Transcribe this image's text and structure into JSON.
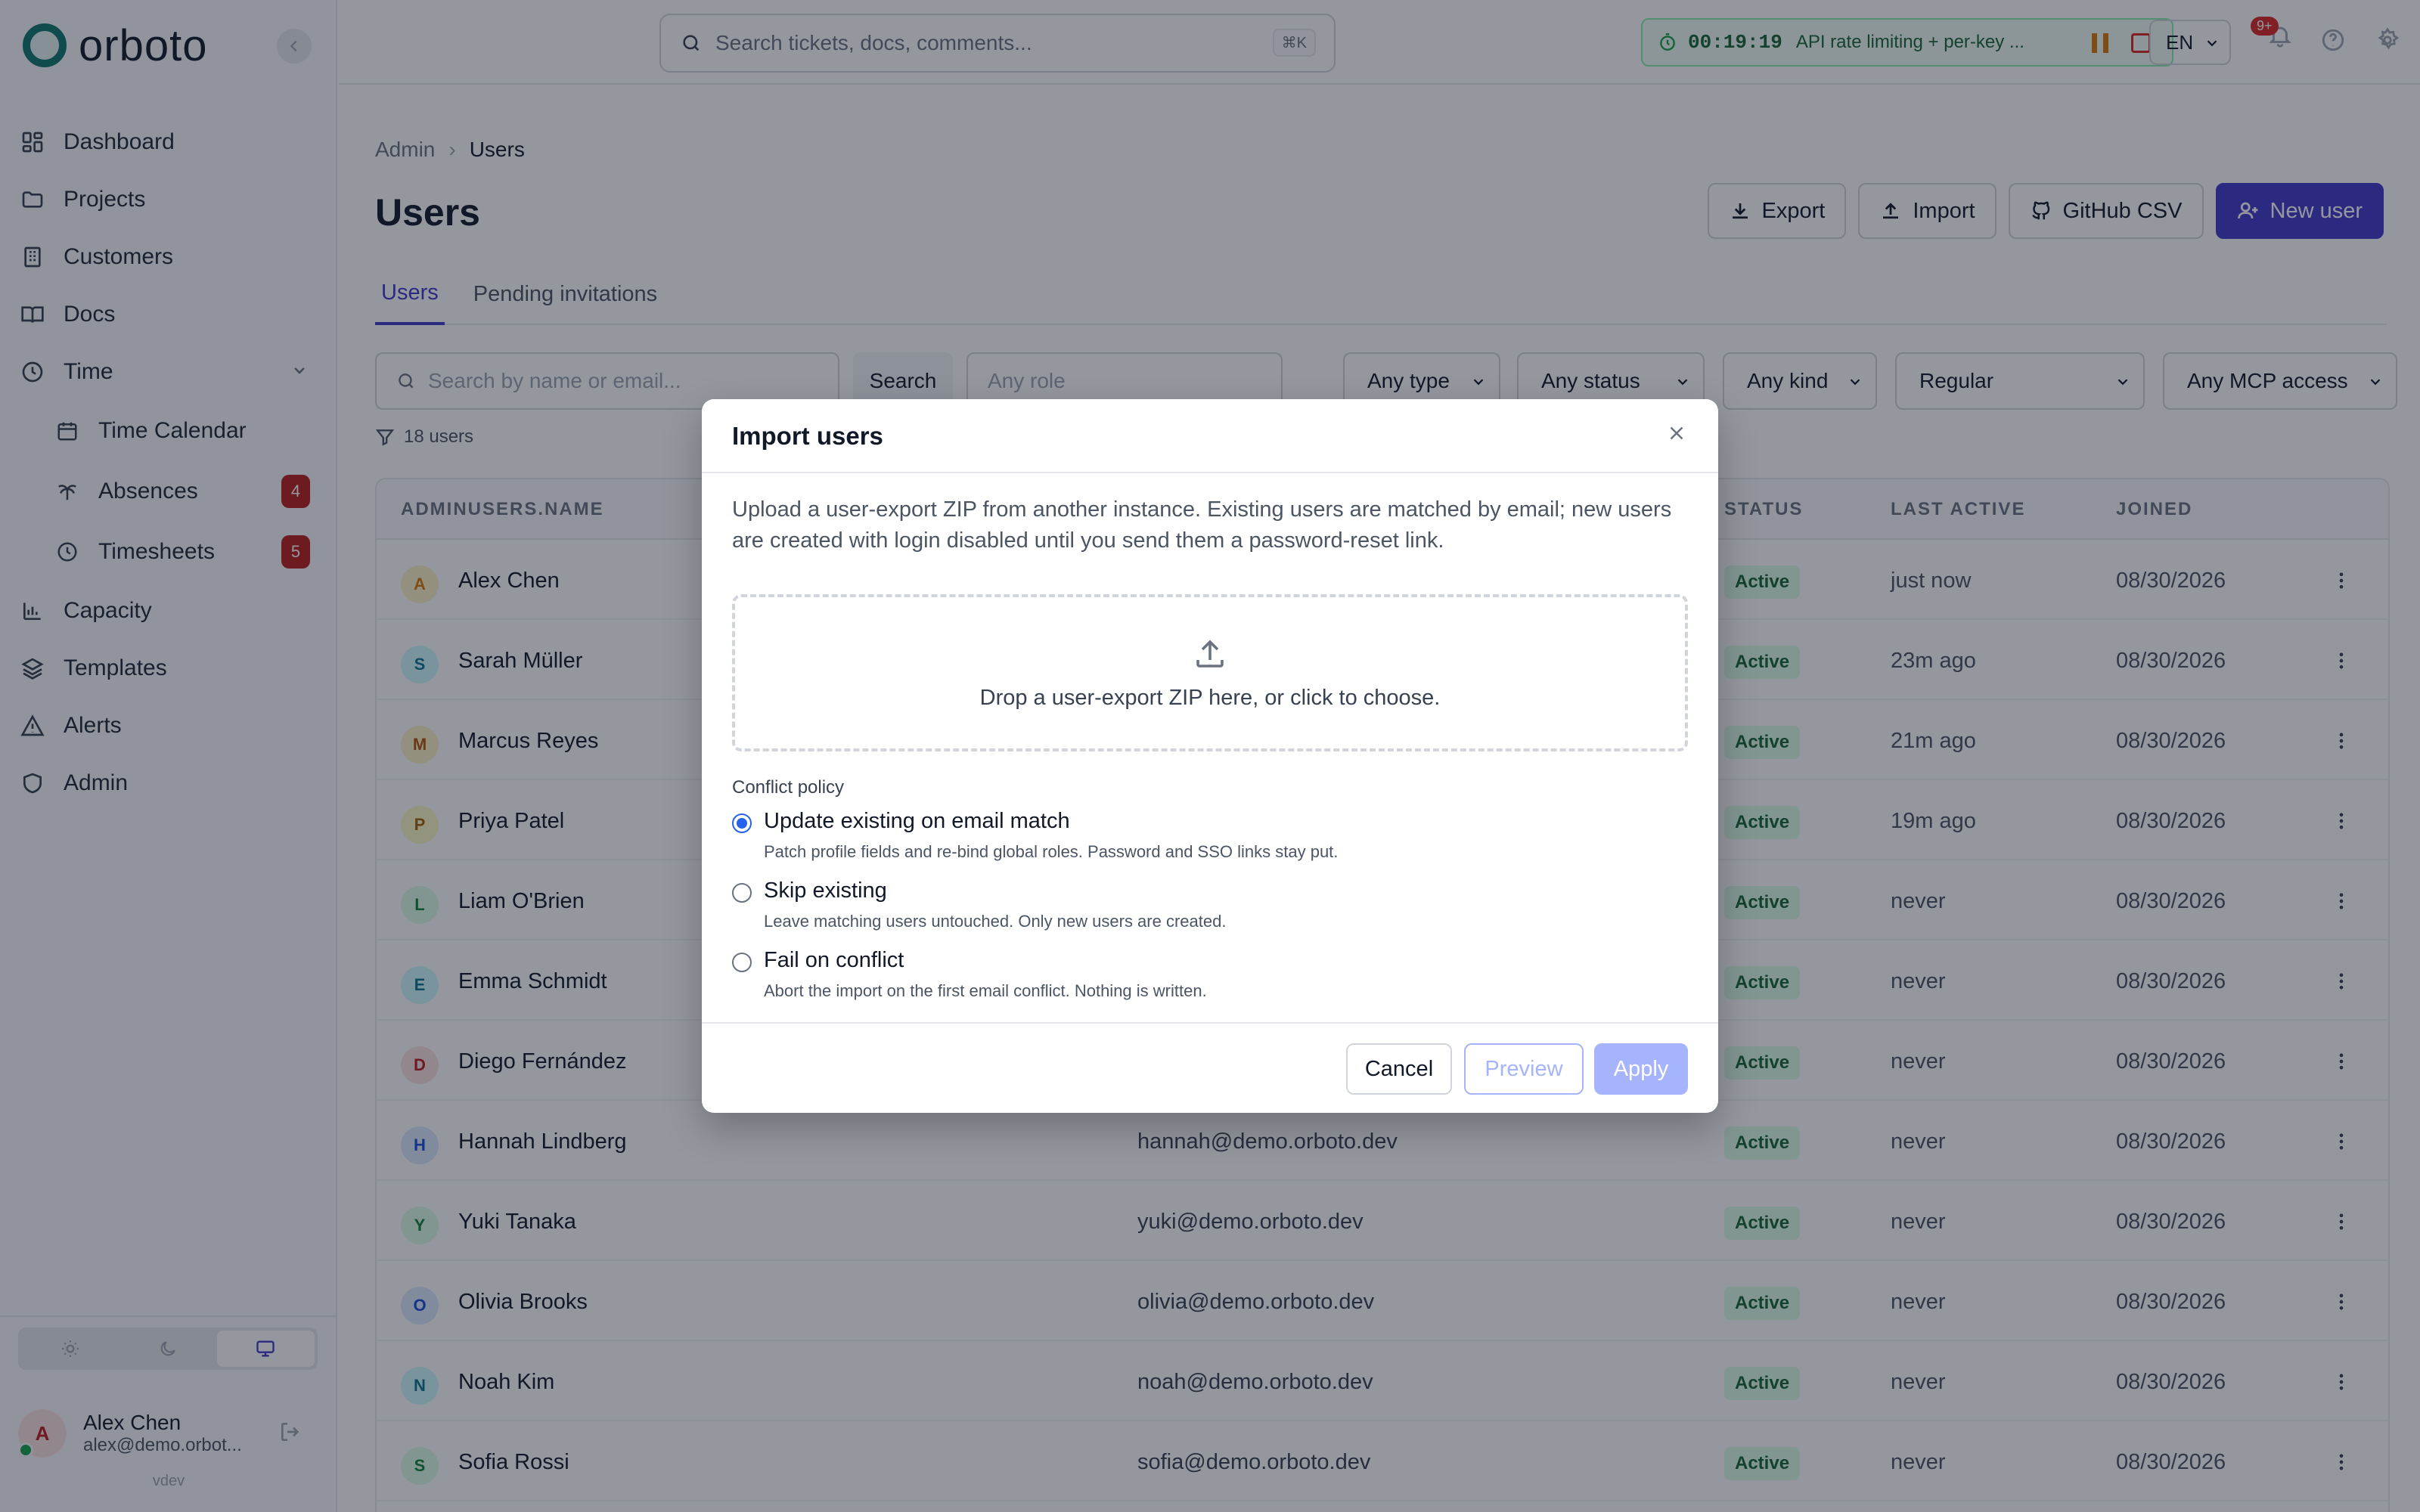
{
  "app": {
    "logo_text": "orboto",
    "version": "vdev"
  },
  "sidebar": {
    "items": [
      {
        "label": "Dashboard",
        "icon": "dashboard-icon"
      },
      {
        "label": "Projects",
        "icon": "folder-icon"
      },
      {
        "label": "Customers",
        "icon": "building-icon"
      },
      {
        "label": "Docs",
        "icon": "book-icon"
      },
      {
        "label": "Time",
        "icon": "clock-icon",
        "expanded": true
      },
      {
        "label": "Time Calendar",
        "icon": "calendar-icon",
        "sub": true
      },
      {
        "label": "Absences",
        "icon": "palm-tree-icon",
        "sub": true,
        "badge": "4"
      },
      {
        "label": "Timesheets",
        "icon": "clock-icon",
        "sub": true,
        "badge": "5"
      },
      {
        "label": "Capacity",
        "icon": "bar-chart-icon"
      },
      {
        "label": "Templates",
        "icon": "layers-icon"
      },
      {
        "label": "Alerts",
        "icon": "alert-triangle-icon"
      },
      {
        "label": "Admin",
        "icon": "shield-icon"
      }
    ],
    "theme_options": [
      "light",
      "dark",
      "system"
    ],
    "theme_selected": "system",
    "user": {
      "name": "Alex Chen",
      "email": "alex@demo.orbot...",
      "initial": "A",
      "online": true
    }
  },
  "topbar": {
    "search_placeholder": "Search tickets, docs, comments...",
    "search_shortcut": "⌘K",
    "timer": {
      "time": "00:19:19",
      "task": "API rate limiting + per-key ..."
    },
    "language": "EN",
    "notifications_badge": "9+"
  },
  "page": {
    "breadcrumb": [
      "Admin",
      "Users"
    ],
    "title": "Users",
    "actions": {
      "export": "Export",
      "import": "Import",
      "github_csv": "GitHub CSV",
      "new_user": "New user"
    },
    "tabs": [
      {
        "label": "Users",
        "active": true
      },
      {
        "label": "Pending invitations",
        "active": false
      }
    ],
    "filters": {
      "search_placeholder": "Search by name or email...",
      "search_button": "Search",
      "role_placeholder": "Any role",
      "selects": [
        "Any type",
        "Any status",
        "Any kind",
        "Regular",
        "Any MCP access"
      ]
    },
    "count_text": "18 users"
  },
  "table": {
    "columns": {
      "name": "ADMINUSERS.NAME",
      "status": "STATUS",
      "last_active": "LAST ACTIVE",
      "joined": "JOINED"
    },
    "rows": [
      {
        "initial": "A",
        "name": "Alex Chen",
        "email": "",
        "status": "Active",
        "last_active": "just now",
        "joined": "08/30/2026",
        "color": "#d97706",
        "bg": "#fef3c7"
      },
      {
        "initial": "S",
        "name": "Sarah Müller",
        "email": "",
        "status": "Active",
        "last_active": "23m ago",
        "joined": "08/30/2026",
        "color": "#0e7490",
        "bg": "#cffafe"
      },
      {
        "initial": "M",
        "name": "Marcus Reyes",
        "email": "",
        "status": "Active",
        "last_active": "21m ago",
        "joined": "08/30/2026",
        "color": "#b45309",
        "bg": "#fef3c7"
      },
      {
        "initial": "P",
        "name": "Priya Patel",
        "email": "",
        "status": "Active",
        "last_active": "19m ago",
        "joined": "08/30/2026",
        "color": "#a16207",
        "bg": "#fef9c3"
      },
      {
        "initial": "L",
        "name": "Liam O'Brien",
        "email": "",
        "status": "Active",
        "last_active": "never",
        "joined": "08/30/2026",
        "color": "#15803d",
        "bg": "#dcfce7"
      },
      {
        "initial": "E",
        "name": "Emma Schmidt",
        "email": "",
        "status": "Active",
        "last_active": "never",
        "joined": "08/30/2026",
        "color": "#0e7490",
        "bg": "#cffafe"
      },
      {
        "initial": "D",
        "name": "Diego Fernández",
        "email": "",
        "status": "Active",
        "last_active": "never",
        "joined": "08/30/2026",
        "color": "#b91c1c",
        "bg": "#fee2e2"
      },
      {
        "initial": "H",
        "name": "Hannah Lindberg",
        "email": "hannah@demo.orboto.dev",
        "status": "Active",
        "last_active": "never",
        "joined": "08/30/2026",
        "color": "#1d4ed8",
        "bg": "#dbeafe"
      },
      {
        "initial": "Y",
        "name": "Yuki Tanaka",
        "email": "yuki@demo.orboto.dev",
        "status": "Active",
        "last_active": "never",
        "joined": "08/30/2026",
        "color": "#15803d",
        "bg": "#dcfce7"
      },
      {
        "initial": "O",
        "name": "Olivia Brooks",
        "email": "olivia@demo.orboto.dev",
        "status": "Active",
        "last_active": "never",
        "joined": "08/30/2026",
        "color": "#1d4ed8",
        "bg": "#dbeafe"
      },
      {
        "initial": "N",
        "name": "Noah Kim",
        "email": "noah@demo.orboto.dev",
        "status": "Active",
        "last_active": "never",
        "joined": "08/30/2026",
        "color": "#0e7490",
        "bg": "#cffafe"
      },
      {
        "initial": "S",
        "name": "Sofia Rossi",
        "email": "sofia@demo.orboto.dev",
        "status": "Active",
        "last_active": "never",
        "joined": "08/30/2026",
        "color": "#15803d",
        "bg": "#dcfce7"
      }
    ]
  },
  "modal": {
    "title": "Import users",
    "description": "Upload a user-export ZIP from another instance. Existing users are matched by email; new users are created with login disabled until you send them a password-reset link.",
    "dropzone_text": "Drop a user-export ZIP here, or click to choose.",
    "policy_label": "Conflict policy",
    "options": [
      {
        "title": "Update existing on email match",
        "desc": "Patch profile fields and re-bind global roles. Password and SSO links stay put.",
        "checked": true
      },
      {
        "title": "Skip existing",
        "desc": "Leave matching users untouched. Only new users are created.",
        "checked": false
      },
      {
        "title": "Fail on conflict",
        "desc": "Abort the import on the first email conflict. Nothing is written.",
        "checked": false
      }
    ],
    "buttons": {
      "cancel": "Cancel",
      "preview": "Preview",
      "apply": "Apply"
    }
  }
}
